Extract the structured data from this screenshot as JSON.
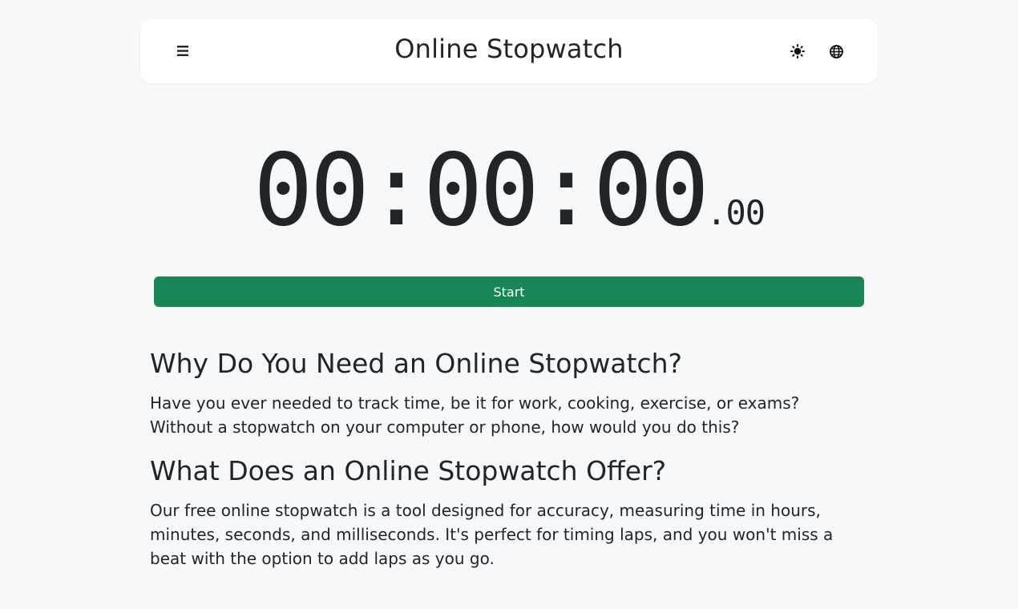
{
  "header": {
    "title": "Online Stopwatch",
    "menu_icon": "hamburger-menu-icon",
    "theme_icon": "sun-theme-icon",
    "language_icon": "globe-icon"
  },
  "stopwatch": {
    "hours": "00",
    "minutes": "00",
    "seconds": "00",
    "separator": ":",
    "milliseconds": ".00",
    "start_label": "Start",
    "start_color": "#198754"
  },
  "content": {
    "heading_1": "Why Do You Need an Online Stopwatch?",
    "paragraph_1": "Have you ever needed to track time, be it for work, cooking, exercise, or exams? Without a stopwatch on your computer or phone, how would you do this?",
    "heading_2": "What Does an Online Stopwatch Offer?",
    "paragraph_2": "Our free online stopwatch is a tool designed for accuracy, measuring time in hours, minutes, seconds, and milliseconds. It's perfect for timing laps, and you won't miss a beat with the option to add laps as you go."
  }
}
